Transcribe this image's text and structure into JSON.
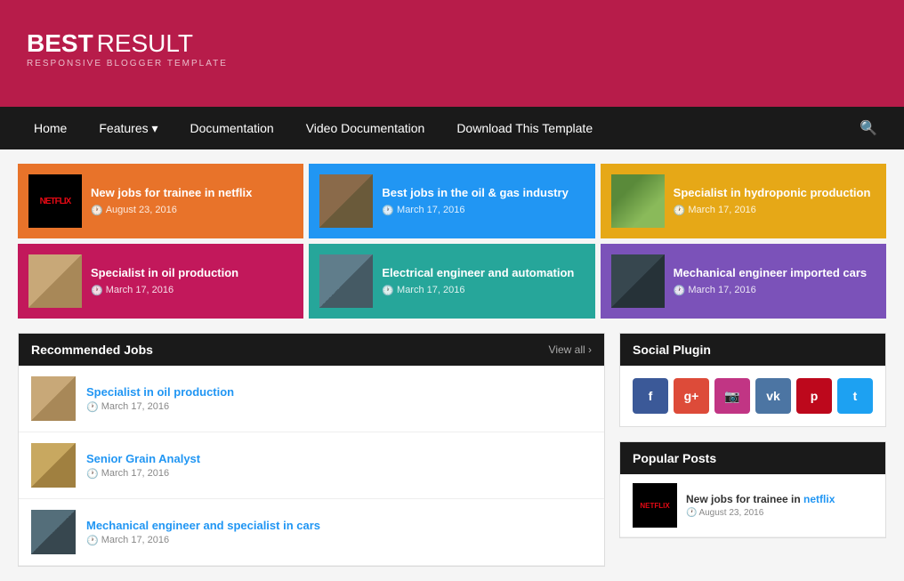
{
  "header": {
    "logo_best": "BEST",
    "logo_result": "RESULT",
    "logo_sub": "RESPONSIVE BLOGGER TEMPLATE"
  },
  "nav": {
    "items": [
      {
        "label": "Home"
      },
      {
        "label": "Features",
        "has_arrow": true
      },
      {
        "label": "Documentation"
      },
      {
        "label": "Video Documentation"
      },
      {
        "label": "Download This Template"
      }
    ]
  },
  "featured": [
    {
      "id": "netflix",
      "color": "orange",
      "title": "New jobs for trainee in netflix",
      "date": "August 23, 2016",
      "thumb_type": "netflix"
    },
    {
      "id": "oil-gas",
      "color": "blue",
      "title": "Best jobs in the oil & gas industry",
      "date": "March 17, 2016",
      "thumb_type": "oil"
    },
    {
      "id": "hydroponic",
      "color": "yellow",
      "title": "Specialist in hydroponic production",
      "date": "March 17, 2016",
      "thumb_type": "hydro"
    },
    {
      "id": "oil-production",
      "color": "pink",
      "title": "Specialist in oil production",
      "date": "March 17, 2016",
      "thumb_type": "oilprod"
    },
    {
      "id": "electrical",
      "color": "teal",
      "title": "Electrical engineer and automation",
      "date": "March 17, 2016",
      "thumb_type": "elec"
    },
    {
      "id": "mechanical",
      "color": "purple",
      "title": "Mechanical engineer imported cars",
      "date": "March 17, 2016",
      "thumb_type": "mech"
    }
  ],
  "recommended": {
    "title": "Recommended Jobs",
    "view_all": "View all",
    "items": [
      {
        "title": "Specialist in oil production",
        "date": "March 17, 2016",
        "thumb_type": "oilprod"
      },
      {
        "title": "Senior Grain Analyst",
        "date": "March 17, 2016",
        "thumb_type": "grain"
      },
      {
        "title": "Mechanical engineer and specialist in cars",
        "date": "March 17, 2016",
        "thumb_type": "cars"
      }
    ]
  },
  "social": {
    "title": "Social Plugin",
    "icons": [
      {
        "label": "f",
        "class": "si-fb",
        "name": "facebook"
      },
      {
        "label": "g+",
        "class": "si-gp",
        "name": "google-plus"
      },
      {
        "label": "📷",
        "class": "si-ig",
        "name": "instagram"
      },
      {
        "label": "vk",
        "class": "si-vk",
        "name": "vk"
      },
      {
        "label": "p",
        "class": "si-pi",
        "name": "pinterest"
      },
      {
        "label": "t",
        "class": "si-tw",
        "name": "twitter"
      }
    ]
  },
  "popular": {
    "title": "Popular Posts",
    "items": [
      {
        "title_part1": "New jobs for trainee in",
        "title_link": "netflix",
        "date": "August 23, 2016",
        "thumb_type": "netflix"
      }
    ]
  }
}
